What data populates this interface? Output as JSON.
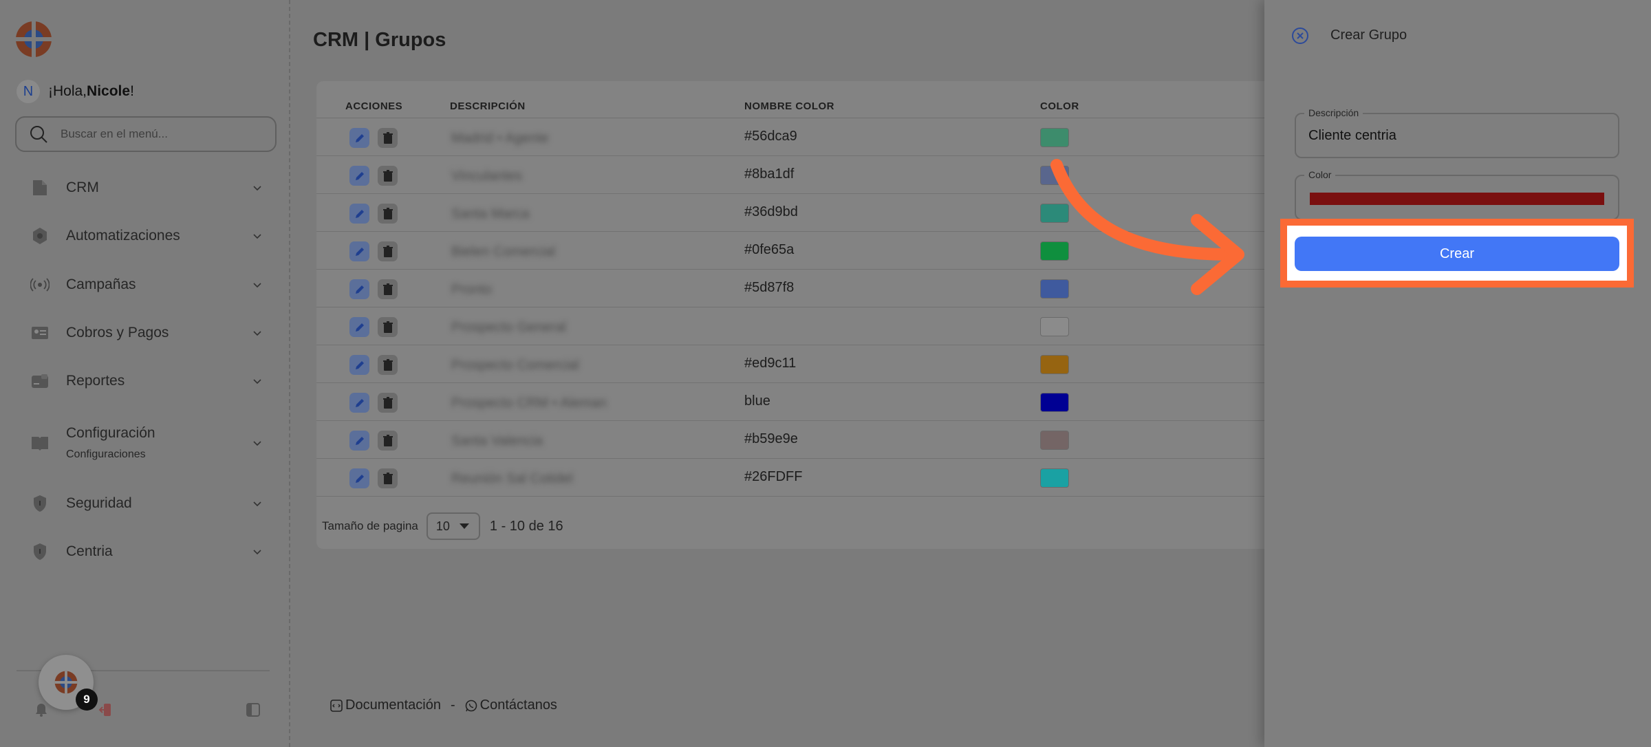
{
  "sidebar": {
    "greeting_prefix": "¡Hola, ",
    "user_name": "Nicole",
    "greeting_suffix": "!",
    "avatar_initial": "N",
    "search_placeholder": "Buscar en el menú...",
    "items": [
      {
        "label": "CRM",
        "icon": "document-icon"
      },
      {
        "label": "Automatizaciones",
        "icon": "hexagon-icon"
      },
      {
        "label": "Campañas",
        "icon": "broadcast-icon"
      },
      {
        "label": "Cobros y Pagos",
        "icon": "id-card-icon"
      },
      {
        "label": "Reportes",
        "icon": "card-icon"
      },
      {
        "label": "Configuración",
        "sublabel": "Configuraciones",
        "icon": "book-icon"
      },
      {
        "label": "Seguridad",
        "icon": "shield-icon"
      },
      {
        "label": "Centria",
        "icon": "shield-icon"
      }
    ],
    "chat_badge": "9"
  },
  "main": {
    "title": "CRM | Grupos",
    "table": {
      "headers": [
        "ACCIONES",
        "DESCRIPCIÓN",
        "NOMBRE COLOR",
        "COLOR"
      ],
      "rows": [
        {
          "desc": "Madrid • Agente",
          "color_name": "#56dca9",
          "swatch": "#3d8c6c"
        },
        {
          "desc": "Vinculantes",
          "color_name": "#8ba1df",
          "swatch": "#59668d"
        },
        {
          "desc": "Santa Marca",
          "color_name": "#36d9bd",
          "swatch": "#2c8a79"
        },
        {
          "desc": "Bielen Comercial",
          "color_name": "#0fe65a",
          "swatch": "#0f8f3e"
        },
        {
          "desc": "Pronto",
          "color_name": "#5d87f8",
          "swatch": "#3f5a9e"
        },
        {
          "desc": "Prospecto General",
          "color_name": "",
          "swatch": "#8b8b8b"
        },
        {
          "desc": "Prospecto Comercial",
          "color_name": "#ed9c11",
          "swatch": "#966411"
        },
        {
          "desc": "Prospecto CRM • Aleman",
          "color_name": "blue",
          "swatch": "#000093"
        },
        {
          "desc": "Santa Valencia",
          "color_name": "#b59e9e",
          "swatch": "#746565"
        },
        {
          "desc": "Reunión Sal Cotidel",
          "color_name": "#26FDFF",
          "swatch": "#1aa1a3"
        }
      ]
    },
    "pager": {
      "label": "Tamaño de pagina",
      "size": "10",
      "info": "1 - 10 de 16"
    },
    "footer": {
      "docs": "Documentación",
      "sep": "-",
      "contact": "Contáctanos"
    }
  },
  "panel": {
    "title": "Crear Grupo",
    "desc_label": "Descripción",
    "desc_value": "Cliente centria",
    "color_label": "Color",
    "color_value": "#7a0f0f",
    "submit_label": "Crear"
  },
  "colors": {
    "accent": "#4277f6",
    "highlight": "#fb6a35"
  }
}
